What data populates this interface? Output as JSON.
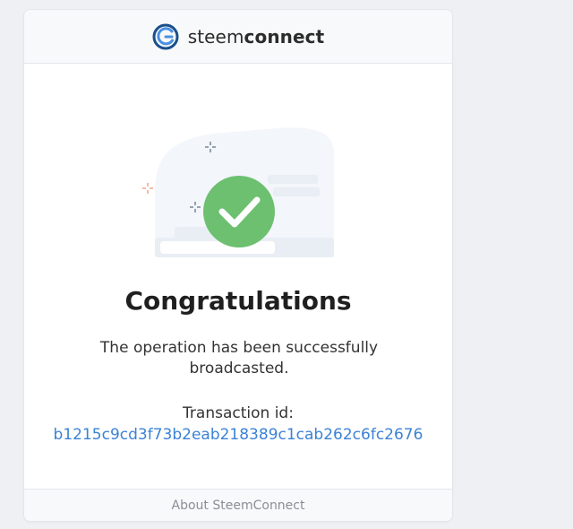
{
  "header": {
    "brand_light": "steem",
    "brand_bold": "connect",
    "logo_icon": "steemconnect-logo-icon"
  },
  "illustration": {
    "icon": "success-checkmark-icon",
    "check_color": "#6cc070",
    "sparkle_colors": [
      "#5a6b80",
      "#f08a6a"
    ]
  },
  "main": {
    "title": "Congratulations",
    "message": "The operation has been successfully broadcasted.",
    "tx_label": "Transaction id:",
    "tx_id": "b1215c9cd3f73b2eab218389c1cab262c6fc2676"
  },
  "footer": {
    "link": "About SteemConnect"
  },
  "colors": {
    "link": "#3b82d6",
    "page_bg": "#eef0f3"
  }
}
